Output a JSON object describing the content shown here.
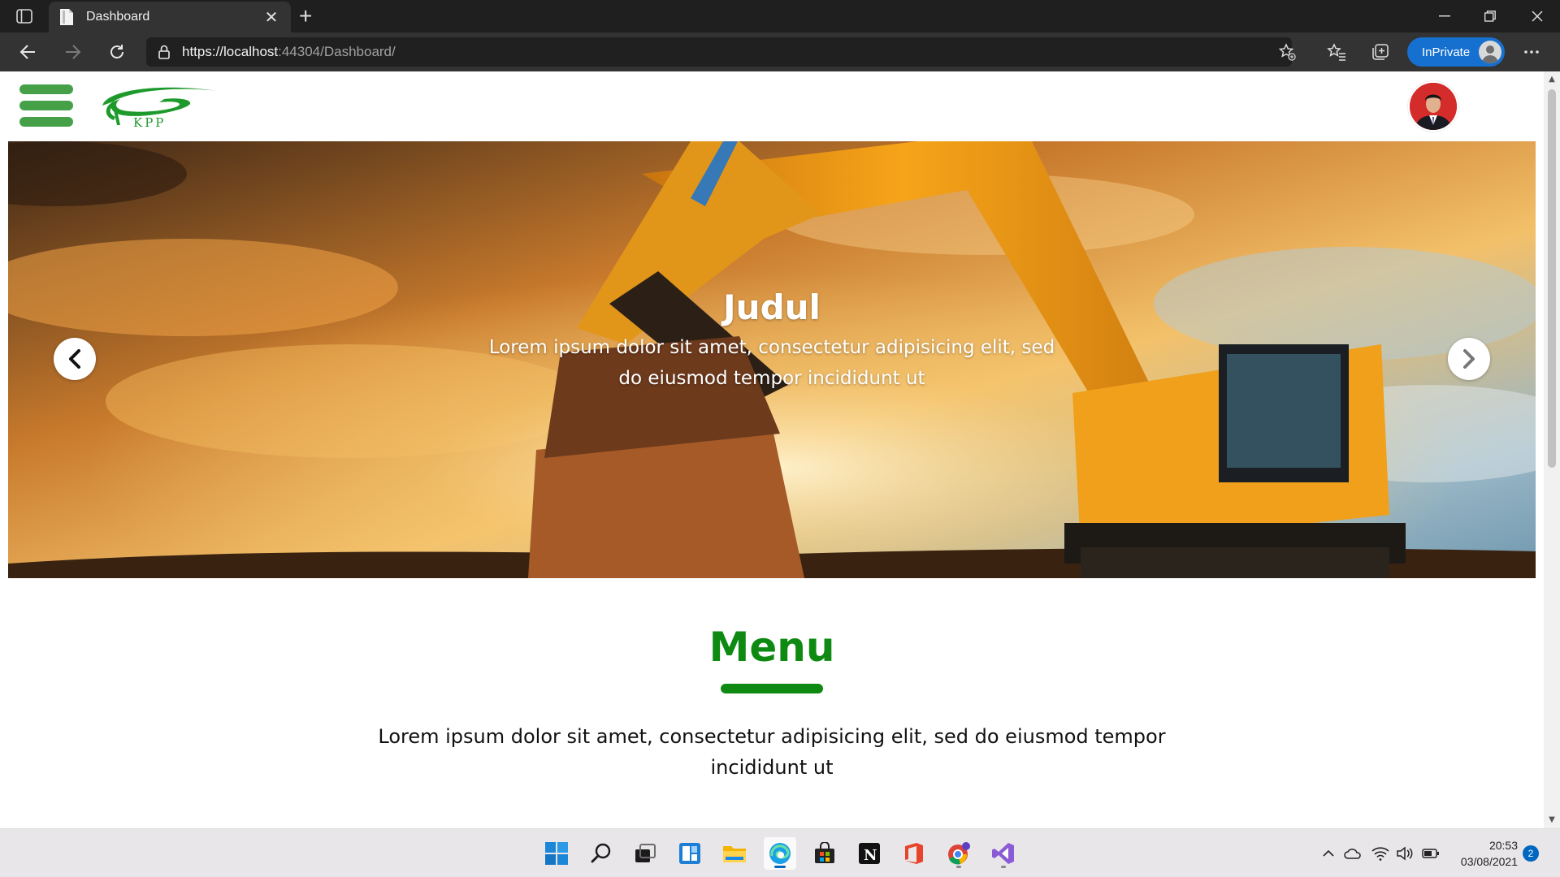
{
  "browser": {
    "tab": {
      "title": "Dashboard",
      "favicon": "page-icon"
    },
    "address": {
      "scheme_host": "https://localhost",
      "port_path": ":44304/Dashboard/"
    },
    "inprivate_label": "InPrivate"
  },
  "site": {
    "logo_text": "KPP",
    "brand_color": "#0e8a12",
    "hamburger_color": "#45a048"
  },
  "hero": {
    "title": "Judul",
    "subtitle": "Lorem ipsum dolor sit amet, consectetur adipisicing elit, sed do eiusmod tempor incididunt ut",
    "prev_icon": "chevron-left-icon",
    "next_icon": "chevron-right-icon"
  },
  "menu": {
    "title": "Menu",
    "description": "Lorem ipsum dolor sit amet, consectetur adipisicing elit, sed do eiusmod tempor incididunt ut"
  },
  "taskbar": {
    "apps": [
      "start",
      "search",
      "task-view",
      "widgets",
      "file-explorer",
      "edge",
      "store",
      "notion",
      "office",
      "chrome",
      "visual-studio"
    ],
    "time": "20:53",
    "date": "03/08/2021",
    "notifications": "2"
  }
}
